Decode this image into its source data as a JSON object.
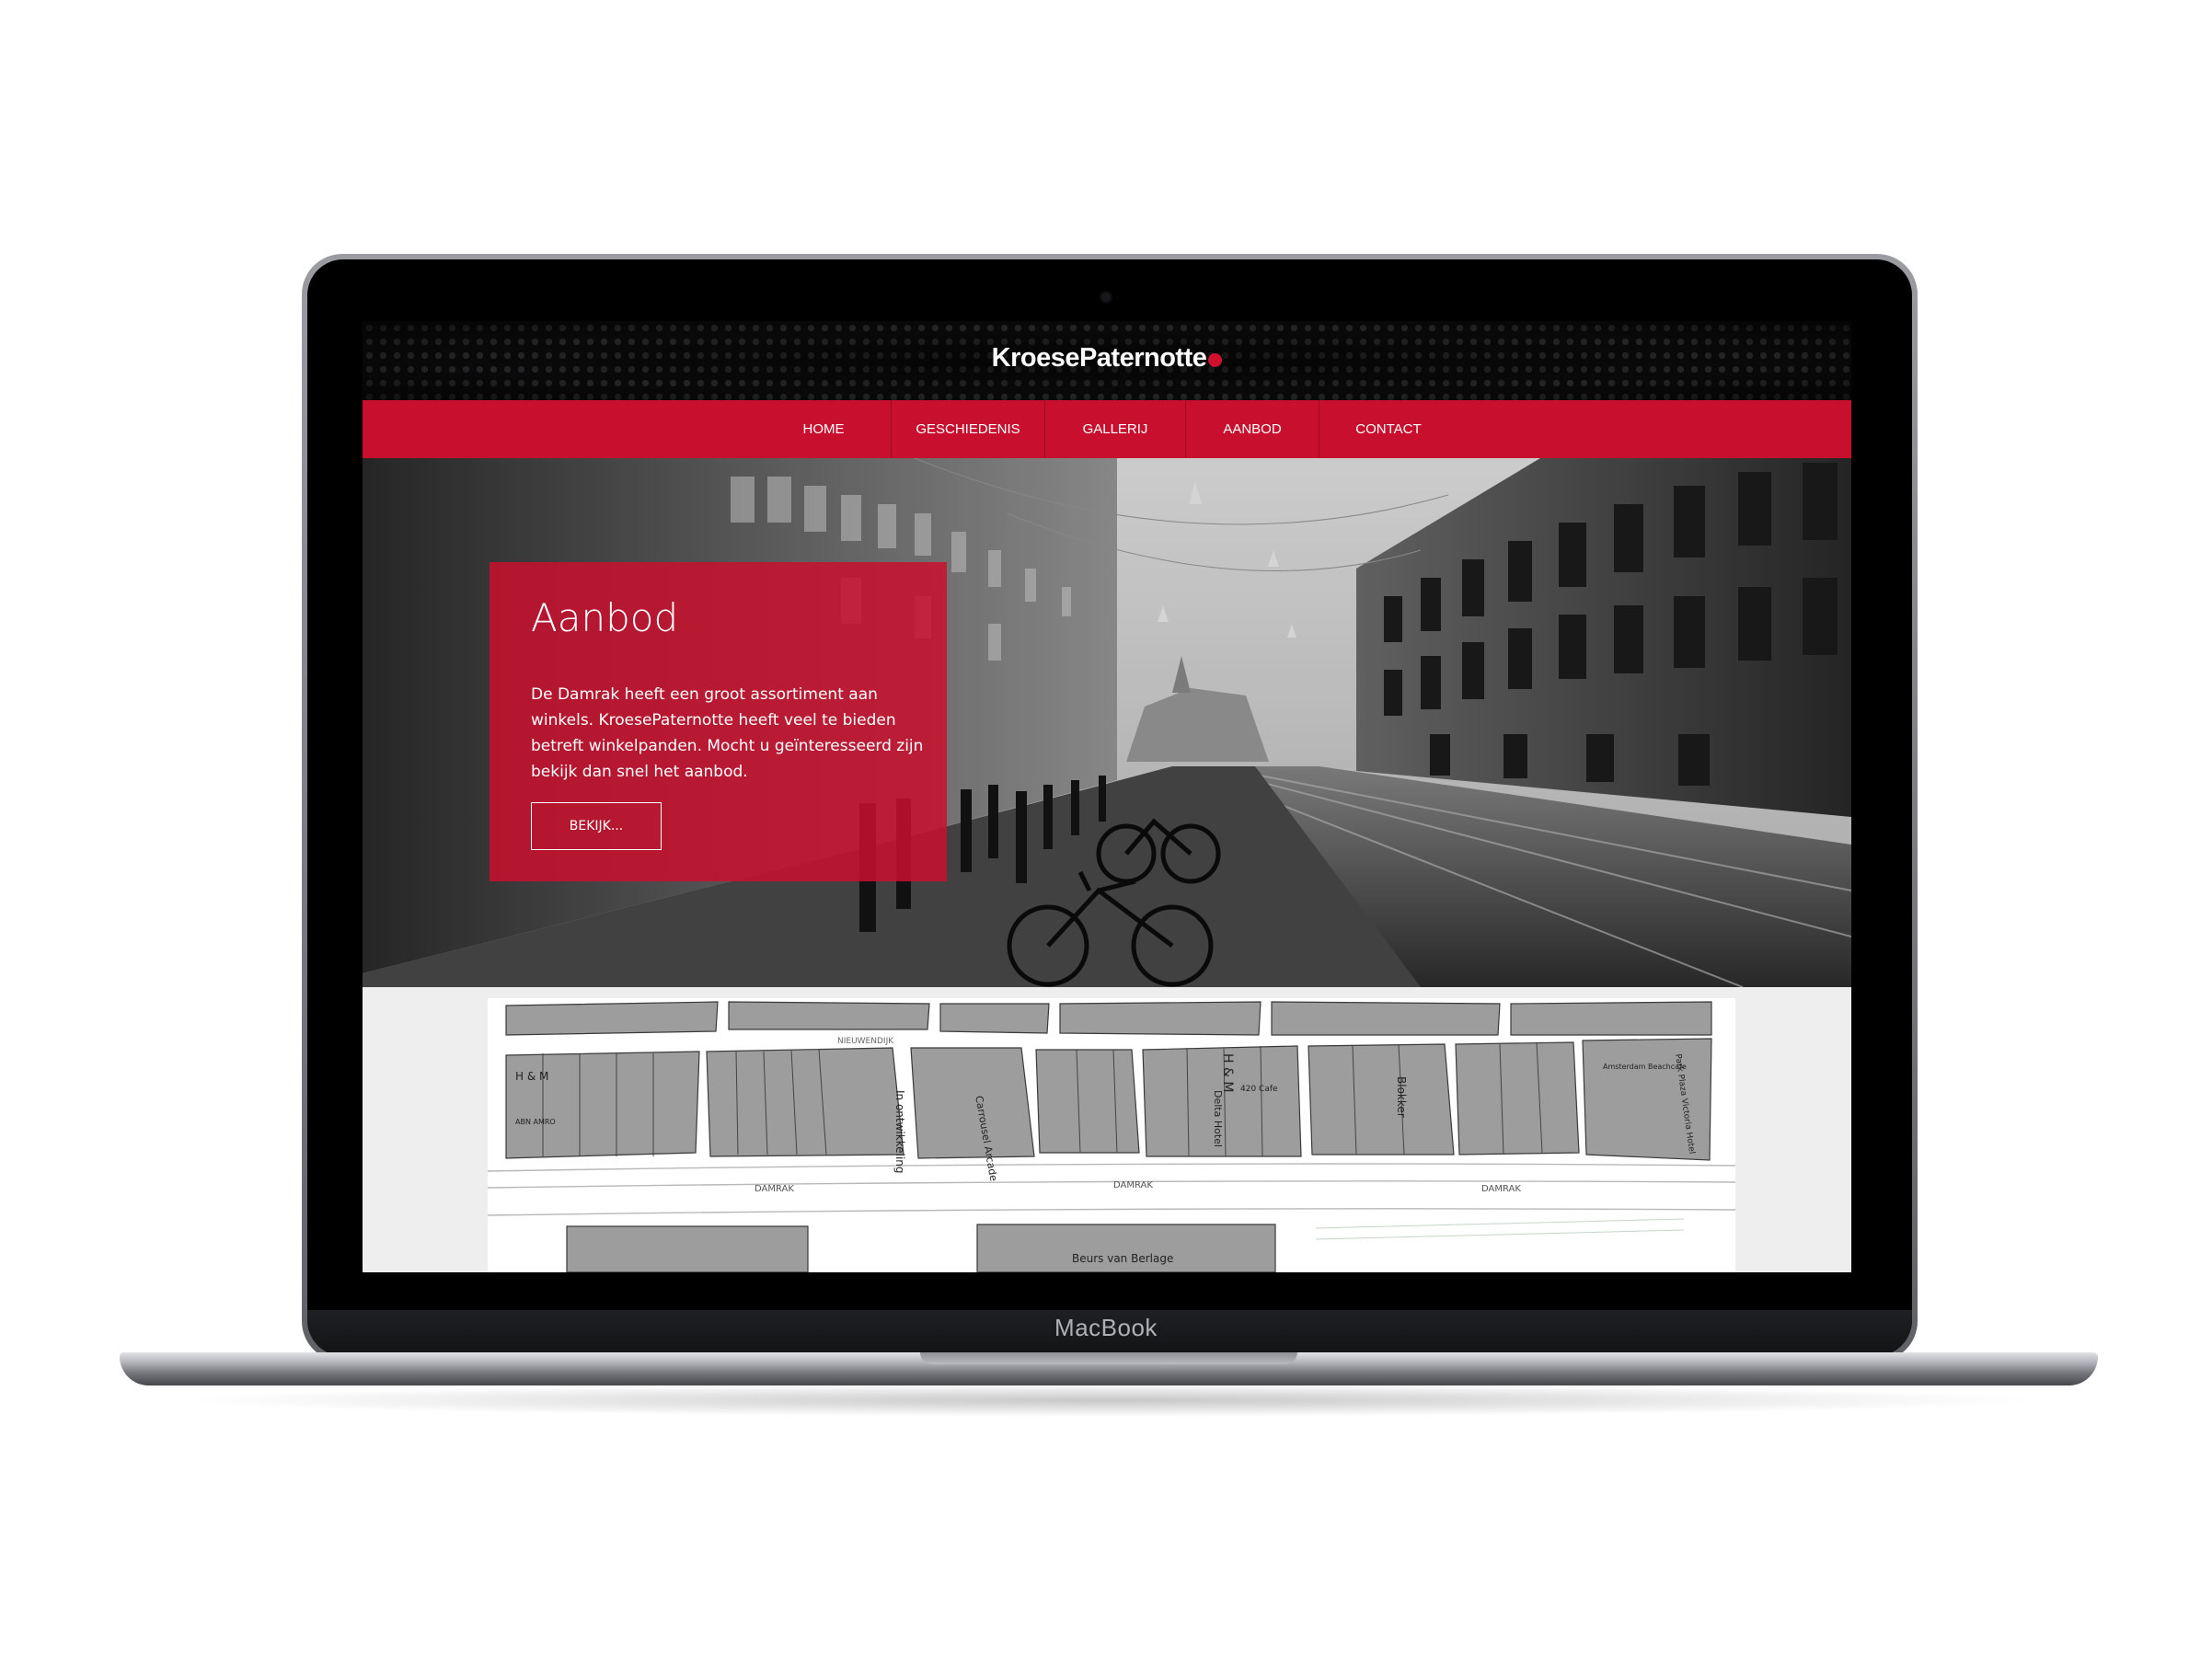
{
  "device": {
    "label": "MacBook"
  },
  "site": {
    "logo": "KroesePaternotte",
    "nav": [
      "HOME",
      "GESCHIEDENIS",
      "GALLERIJ",
      "AANBOD",
      "CONTACT"
    ],
    "hero": {
      "title": "Aanbod",
      "text": "De Damrak heeft een groot assortiment aan winkels. KroesePaternotte heeft veel te bieden betreft winkelpanden. Mocht u geïnteresseerd zijn bekijk dan snel het aanbod.",
      "button": "BEKIJK..."
    },
    "map": {
      "labels": {
        "hm_left": "H & M",
        "abn": "ABN AMRO",
        "ontwikkeling": "In ontwikkeling",
        "carrousel": "Carrousel Arcade",
        "hm_mid": "H & M",
        "delta": "Delta Hotel",
        "cafe": "420 Cafe",
        "blokker": "Blokker",
        "amsterdam": "Amsterdam Beachcafe",
        "park_plaza": "Park Plaza Victoria Hotel",
        "nieuwendijk": "NIEUWENDIJK",
        "damrak_1": "DAMRAK",
        "damrak_2": "DAMRAK",
        "damrak_3": "DAMRAK",
        "beurs": "Beurs van Berlage"
      }
    }
  },
  "colors": {
    "brand_red": "#c8102e",
    "header_bg": "#0b0b0c",
    "map_block": "#9d9d9d"
  }
}
